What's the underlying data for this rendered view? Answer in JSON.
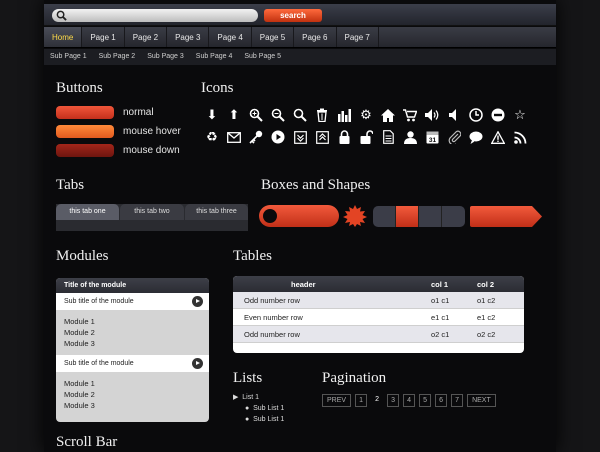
{
  "search": {
    "placeholder": "",
    "button_label": "search"
  },
  "nav": {
    "items": [
      "Home",
      "Page 1",
      "Page 2",
      "Page 3",
      "Page 4",
      "Page 5",
      "Page 6",
      "Page 7"
    ]
  },
  "subnav": {
    "items": [
      "Sub Page 1",
      "Sub Page 2",
      "Sub Page 3",
      "Sub Page 4",
      "Sub Page 5"
    ]
  },
  "sections": {
    "buttons": "Buttons",
    "icons": "Icons",
    "tabs": "Tabs",
    "boxes": "Boxes and Shapes",
    "modules": "Modules",
    "tables": "Tables",
    "lists": "Lists",
    "pagination": "Pagination",
    "scrollbar": "Scroll Bar"
  },
  "buttons": {
    "normal": "normal",
    "hover": "mouse hover",
    "down": "mouse down",
    "colors": {
      "normal": "#e0402a",
      "hover": "#ef6a2c",
      "down": "#8f1e15"
    }
  },
  "icons": {
    "row1": [
      "arrow-down-icon",
      "arrow-up-icon",
      "zoom-in-icon",
      "zoom-out-icon",
      "search-icon",
      "trash-icon",
      "bar-chart-icon",
      "gear-icon",
      "home-icon",
      "cart-icon",
      "volume-icon",
      "mute-icon",
      "clock-icon",
      "minus-circle-icon",
      "star-icon"
    ],
    "row2": [
      "recycle-icon",
      "mail-icon",
      "key-icon",
      "play-circle-icon",
      "download-icon",
      "upload-icon",
      "lock-icon",
      "unlock-icon",
      "document-icon",
      "user-icon",
      "calendar-icon",
      "paperclip-icon",
      "comment-icon",
      "warning-icon",
      "rss-icon"
    ],
    "calendar_day": "31"
  },
  "tabs": {
    "items": [
      "this tab one",
      "this tab two",
      "this tab three"
    ]
  },
  "module": {
    "title": "Title of the module",
    "groups": [
      {
        "subtitle": "Sub title of the module",
        "items": [
          "Module 1",
          "Module 2",
          "Module 3"
        ]
      },
      {
        "subtitle": "Sub title of the module",
        "items": [
          "Module 1",
          "Module 2",
          "Module 3"
        ]
      }
    ]
  },
  "table": {
    "headers": [
      "header",
      "col 1",
      "col 2"
    ],
    "rows": [
      [
        "Odd number row",
        "o1 c1",
        "o1 c2"
      ],
      [
        "Even number row",
        "e1 c1",
        "e1 c2"
      ],
      [
        "Odd number row",
        "o2 c1",
        "o2 c2"
      ]
    ]
  },
  "lists": {
    "item": "List 1",
    "sub": [
      "Sub List 1",
      "Sub List 1"
    ]
  },
  "pagination": {
    "prev": "PREV",
    "pages": [
      "1",
      "2",
      "3",
      "4",
      "5",
      "6",
      "7"
    ],
    "current": "2",
    "next": "NEXT"
  }
}
